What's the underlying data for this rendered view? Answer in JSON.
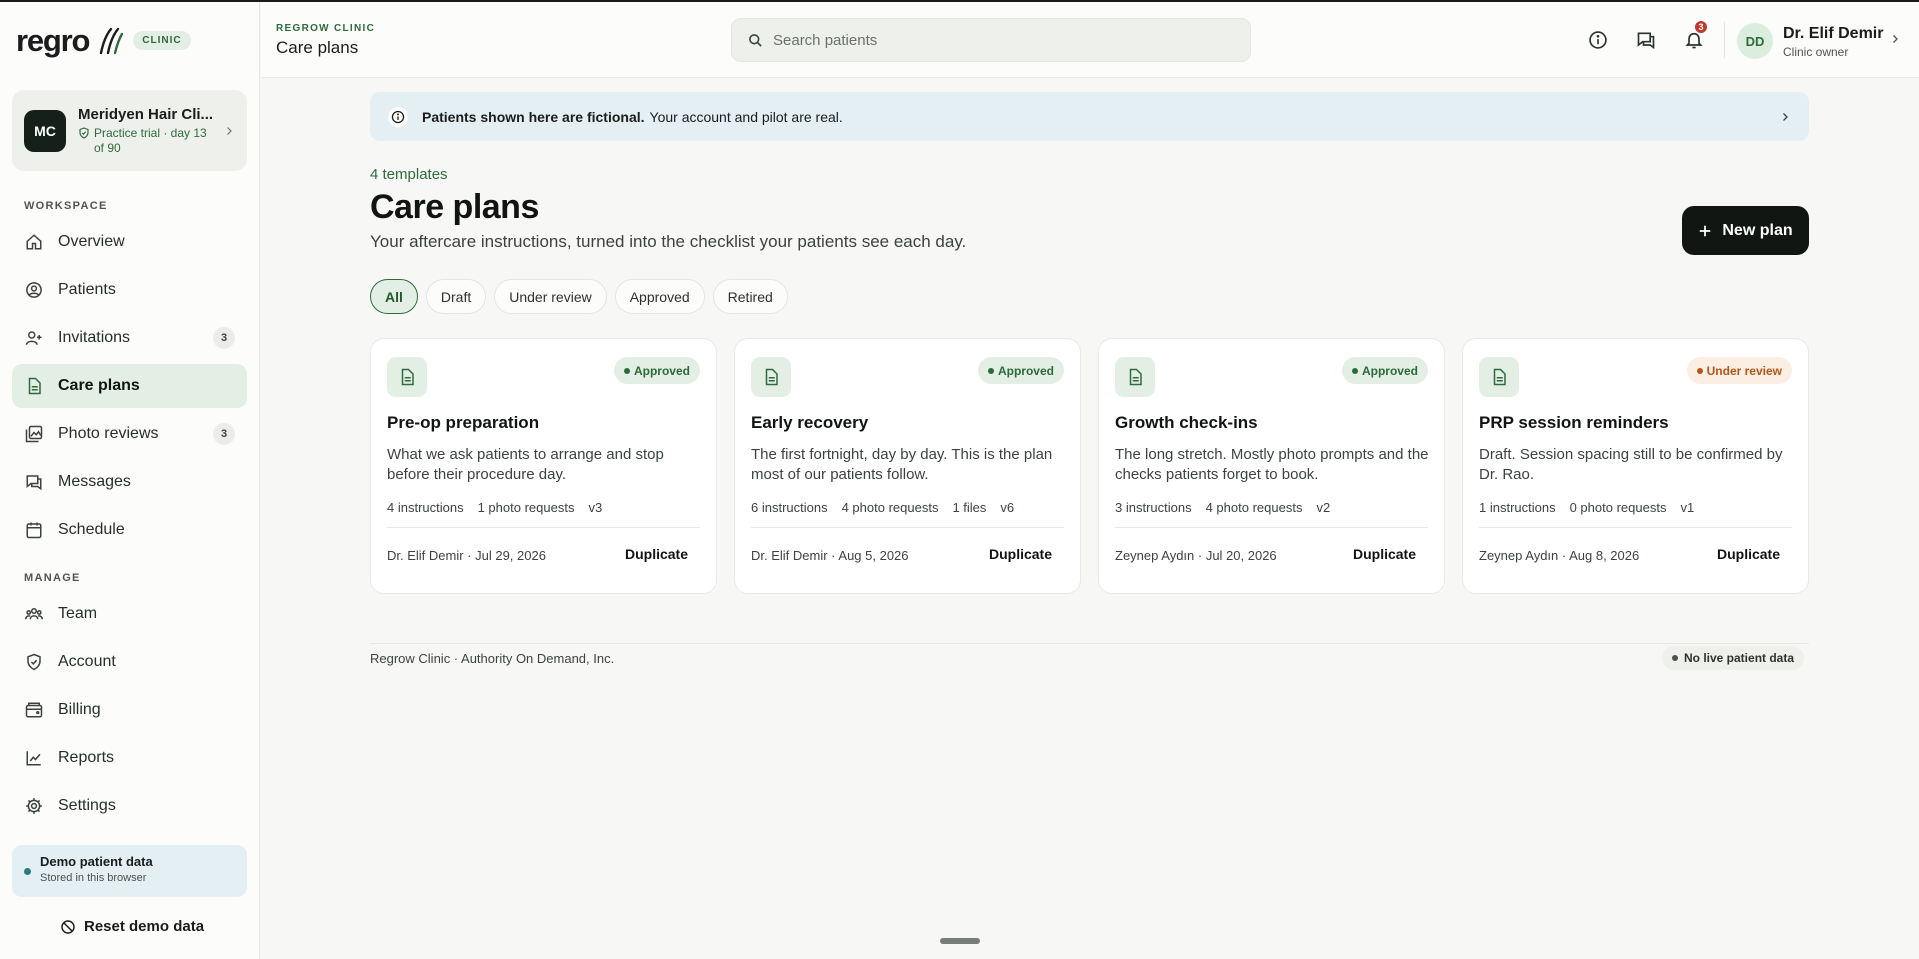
{
  "brand": {
    "logo_text": "regro",
    "chip": "CLINIC"
  },
  "org": {
    "initials": "MC",
    "name": "Meridyen Hair Cli...",
    "trial": "Practice trial · day 13 of 90"
  },
  "sidebar": {
    "workspace_label": "WORKSPACE",
    "manage_label": "MANAGE",
    "workspace_items": [
      {
        "label": "Overview",
        "icon": "home-icon"
      },
      {
        "label": "Patients",
        "icon": "user-circle-icon"
      },
      {
        "label": "Invitations",
        "icon": "user-plus-icon",
        "count": "3"
      },
      {
        "label": "Care plans",
        "icon": "document-icon",
        "active": true
      },
      {
        "label": "Photo reviews",
        "icon": "photos-icon",
        "count": "3"
      },
      {
        "label": "Messages",
        "icon": "chat-icon"
      },
      {
        "label": "Schedule",
        "icon": "calendar-icon"
      }
    ],
    "manage_items": [
      {
        "label": "Team",
        "icon": "team-icon"
      },
      {
        "label": "Account",
        "icon": "shield-icon"
      },
      {
        "label": "Billing",
        "icon": "wallet-icon"
      },
      {
        "label": "Reports",
        "icon": "chart-icon"
      },
      {
        "label": "Settings",
        "icon": "gear-icon"
      }
    ],
    "demo": {
      "title": "Demo patient data",
      "subtitle": "Stored in this browser"
    },
    "reset_label": "Reset demo data"
  },
  "topbar": {
    "eyebrow": "REGROW CLINIC",
    "title": "Care plans",
    "search_placeholder": "Search patients",
    "notification_count": "3",
    "user": {
      "initials": "DD",
      "name": "Dr. Elif Demir",
      "role": "Clinic owner"
    }
  },
  "banner": {
    "bold": "Patients shown here are fictional.",
    "text": "Your account and pilot are real."
  },
  "page": {
    "eyebrow": "4 templates",
    "title": "Care plans",
    "subtitle": "Your aftercare instructions, turned into the checklist your patients see each day.",
    "new_plan_label": "New plan"
  },
  "filters": [
    "All",
    "Draft",
    "Under review",
    "Approved",
    "Retired"
  ],
  "active_filter": "All",
  "plans": [
    {
      "status": "Approved",
      "status_kind": "approved",
      "title": "Pre-op preparation",
      "description": "What we ask patients to arrange and stop before their procedure day.",
      "meta": [
        "4 instructions",
        "1 photo requests",
        "v3"
      ],
      "footer": "Dr. Elif Demir · Jul 29, 2026",
      "action": "Duplicate"
    },
    {
      "status": "Approved",
      "status_kind": "approved",
      "title": "Early recovery",
      "description": "The first fortnight, day by day. This is the plan most of our patients follow.",
      "meta": [
        "6 instructions",
        "4 photo requests",
        "1 files",
        "v6"
      ],
      "footer": "Dr. Elif Demir · Aug 5, 2026",
      "action": "Duplicate"
    },
    {
      "status": "Approved",
      "status_kind": "approved",
      "title": "Growth check-ins",
      "description": "The long stretch. Mostly photo prompts and the checks patients forget to book.",
      "meta": [
        "3 instructions",
        "4 photo requests",
        "v2"
      ],
      "footer": "Zeynep Aydın · Jul 20, 2026",
      "action": "Duplicate"
    },
    {
      "status": "Under review",
      "status_kind": "review",
      "title": "PRP session reminders",
      "description": "Draft. Session spacing still to be confirmed by Dr. Rao.",
      "meta": [
        "1 instructions",
        "0 photo requests",
        "v1"
      ],
      "footer": "Zeynep Aydın · Aug 8, 2026",
      "action": "Duplicate"
    }
  ],
  "footer": {
    "text": "Regrow Clinic · Authority On Demand, Inc.",
    "badge": "No live patient data"
  }
}
